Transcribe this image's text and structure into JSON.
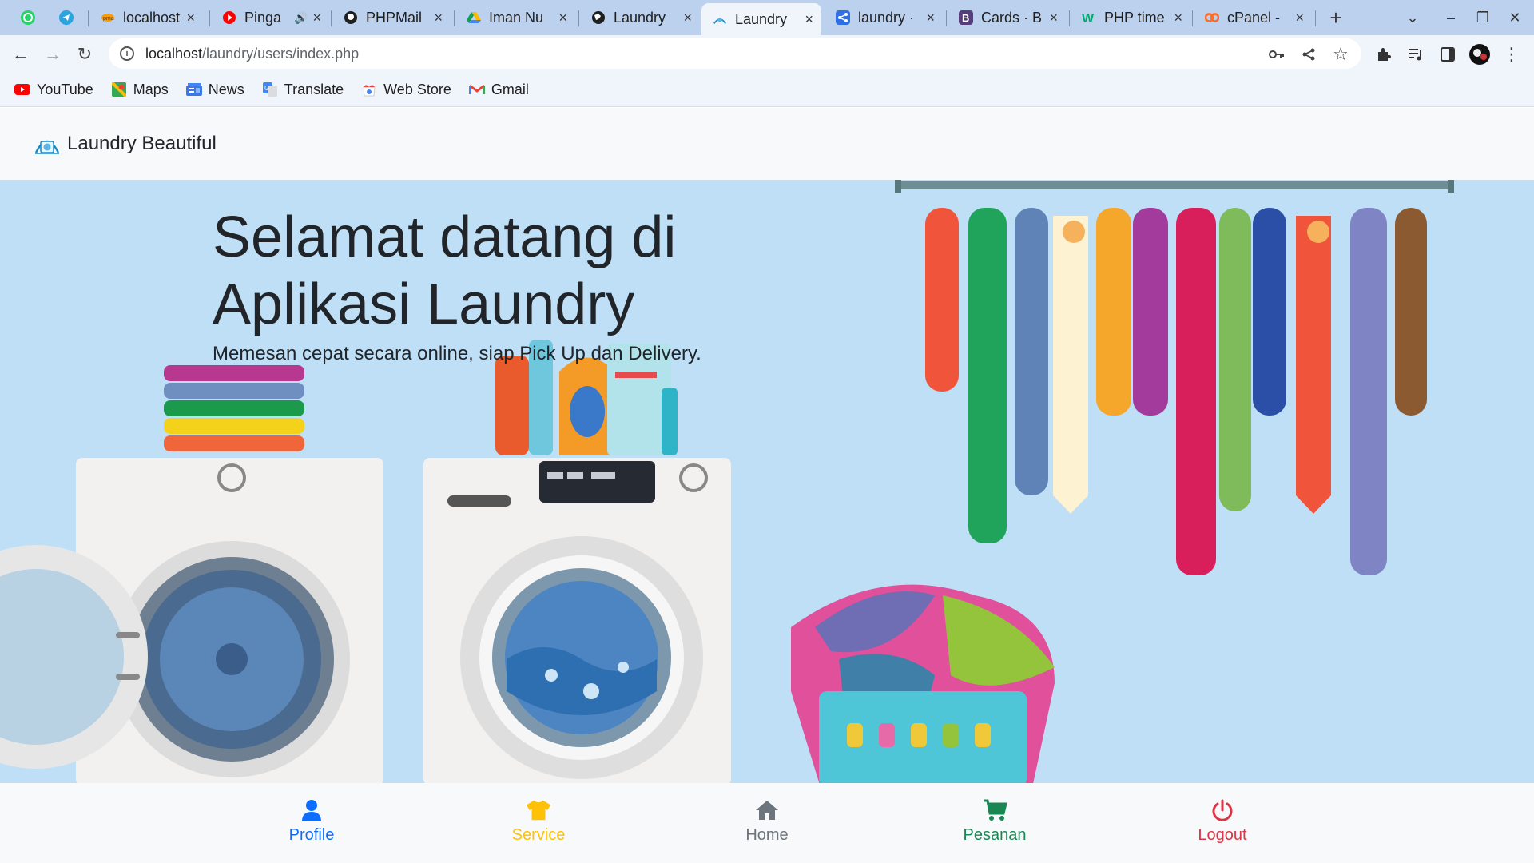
{
  "browser": {
    "tabs": [
      {
        "title": "localhost",
        "icon": "phpmyadmin-icon"
      },
      {
        "title": "Pinga",
        "icon": "youtube-icon",
        "audio": true
      },
      {
        "title": "PHPMail",
        "icon": "github-icon"
      },
      {
        "title": "Iman Nu",
        "icon": "drive-icon"
      },
      {
        "title": "Laundry",
        "icon": "globe-icon"
      },
      {
        "title": "Laundry",
        "icon": "laundry-logo-icon",
        "active": true
      },
      {
        "title": "laundry ·",
        "icon": "share-icon"
      },
      {
        "title": "Cards · B",
        "icon": "bootstrap-icon"
      },
      {
        "title": "PHP time",
        "icon": "w3schools-icon"
      },
      {
        "title": "cPanel - ",
        "icon": "cpanel-icon"
      }
    ],
    "new_tab": "+",
    "close_glyph": "×",
    "address": {
      "host": "localhost",
      "path": "/laundry/users/index.php"
    },
    "bookmarks": [
      {
        "label": "YouTube",
        "icon": "youtube-icon"
      },
      {
        "label": "Maps",
        "icon": "maps-icon"
      },
      {
        "label": "News",
        "icon": "news-icon"
      },
      {
        "label": "Translate",
        "icon": "translate-icon"
      },
      {
        "label": "Web Store",
        "icon": "webstore-icon"
      },
      {
        "label": "Gmail",
        "icon": "gmail-icon"
      }
    ]
  },
  "page": {
    "brand": "Laundry Beautiful",
    "hero": {
      "title_line1": "Selamat datang di",
      "title_line2": "Aplikasi Laundry",
      "subtitle": "Memesan cepat secara online, siap Pick Up dan Delivery."
    },
    "bottom_nav": [
      {
        "label": "Profile",
        "icon": "user-icon",
        "color": "#0d6efd"
      },
      {
        "label": "Service",
        "icon": "shirt-icon",
        "color": "#ffc107"
      },
      {
        "label": "Home",
        "icon": "home-icon",
        "color": "#6c757d"
      },
      {
        "label": "Pesanan",
        "icon": "cart-icon",
        "color": "#198754"
      },
      {
        "label": "Logout",
        "icon": "power-icon",
        "color": "#dc3545"
      }
    ]
  },
  "colors": {
    "tabbar": "#bcd1ee",
    "toolbar": "#f0f5fc",
    "hero_bg": "#bedff5"
  }
}
